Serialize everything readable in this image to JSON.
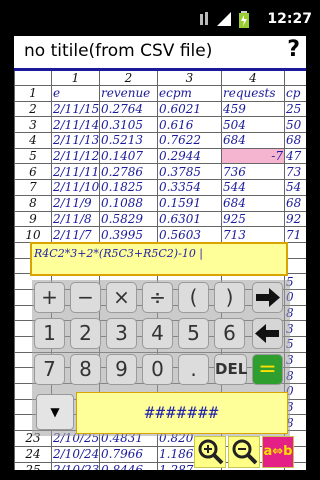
{
  "status": {
    "time": "12:27"
  },
  "header": {
    "title": "no titile(from CSV file)",
    "help": "?"
  },
  "sheet": {
    "col_headers": [
      "",
      "1",
      "2",
      "3",
      "4",
      ""
    ],
    "rows": [
      {
        "n": "1",
        "c1": "e",
        "c2": "revenue",
        "c3": "ecpm",
        "c4": "requests",
        "c5": "cp"
      },
      {
        "n": "2",
        "c1": "2/11/15",
        "c2": "0.2764",
        "c3": "0.6021",
        "c4": "459",
        "c5": "25"
      },
      {
        "n": "3",
        "c1": "2/11/14",
        "c2": "0.3105",
        "c3": "0.616",
        "c4": "504",
        "c5": "50"
      },
      {
        "n": "4",
        "c1": "2/11/13",
        "c2": "0.5213",
        "c3": "0.7622",
        "c4": "684",
        "c5": "68"
      },
      {
        "n": "5",
        "c1": "2/11/12",
        "c2": "0.1407",
        "c3": "0.2944",
        "c4": "-7",
        "c5": "47"
      },
      {
        "n": "6",
        "c1": "2/11/11",
        "c2": "0.2786",
        "c3": "0.3785",
        "c4": "736",
        "c5": "73"
      },
      {
        "n": "7",
        "c1": "2/11/10",
        "c2": "0.1825",
        "c3": "0.3354",
        "c4": "544",
        "c5": "54"
      },
      {
        "n": "8",
        "c1": "2/11/9",
        "c2": "0.1088",
        "c3": "0.1591",
        "c4": "684",
        "c5": "68"
      },
      {
        "n": "9",
        "c1": "2/11/8",
        "c2": "0.5829",
        "c3": "0.6301",
        "c4": "925",
        "c5": "92"
      },
      {
        "n": "10",
        "c1": "2/11/7",
        "c2": "0.3995",
        "c3": "0.5603",
        "c4": "713",
        "c5": "71"
      },
      {
        "n": "",
        "c1": "",
        "c2": "",
        "c3": "",
        "c4": "",
        "c5": ""
      },
      {
        "n": "",
        "c1": "",
        "c2": "",
        "c3": "",
        "c4": "",
        "c5": ""
      },
      {
        "n": "",
        "c1": "",
        "c2": "",
        "c3": "",
        "c4": "",
        "c5": "5"
      },
      {
        "n": "",
        "c1": "",
        "c2": "",
        "c3": "",
        "c4": "",
        "c5": "0"
      },
      {
        "n": "",
        "c1": "",
        "c2": "",
        "c3": "",
        "c4": "",
        "c5": "8"
      },
      {
        "n": "",
        "c1": "",
        "c2": "",
        "c3": "",
        "c4": "",
        "c5": "3"
      },
      {
        "n": "",
        "c1": "",
        "c2": "",
        "c3": "",
        "c4": "",
        "c5": "5"
      },
      {
        "n": "",
        "c1": "",
        "c2": "",
        "c3": "",
        "c4": "",
        "c5": "3"
      },
      {
        "n": "",
        "c1": "",
        "c2": "",
        "c3": "",
        "c4": "",
        "c5": "8"
      },
      {
        "n": "",
        "c1": "",
        "c2": "",
        "c3": "",
        "c4": "",
        "c5": "0"
      },
      {
        "n": "",
        "c1": "",
        "c2": "",
        "c3": "",
        "c4": "",
        "c5": "3"
      },
      {
        "n": "",
        "c1": "",
        "c2": "",
        "c3": "",
        "c4": "",
        "c5": "8"
      },
      {
        "n": "23",
        "c1": "2/10/25",
        "c2": "0.4831",
        "c3": "0.820",
        "c4": "",
        "c5": ""
      },
      {
        "n": "24",
        "c1": "2/10/24",
        "c2": "0.7966",
        "c3": "1.186",
        "c4": "",
        "c5": ""
      },
      {
        "n": "25",
        "c1": "2/10/23",
        "c2": "0.8446",
        "c3": "1.287",
        "c4": "",
        "c5": ""
      }
    ]
  },
  "formula": {
    "text": "R4C2*3+2*(R5C3+R5C2)-10 |"
  },
  "keypad": {
    "row1": [
      "+",
      "−",
      "×",
      "÷",
      "(",
      ")"
    ],
    "row2": [
      "1",
      "2",
      "3",
      "4",
      "5",
      "6"
    ],
    "row3": [
      "7",
      "8",
      "9",
      "0",
      "."
    ],
    "del": "DEL",
    "eq": "="
  },
  "bottom": {
    "dropdown": "▼",
    "value": "#######",
    "ab_label": "a⇔b"
  },
  "colors": {
    "accent_blue": "#1a1a9a",
    "formula_bg": "#ffff99",
    "pink_cell": "#f5b5d0",
    "eq_green": "#2e9e2e",
    "ab_magenta": "#e41f86"
  }
}
